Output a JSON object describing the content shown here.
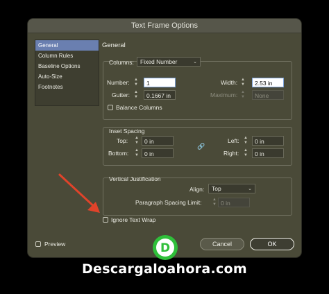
{
  "window": {
    "title": "Text Frame Options"
  },
  "sidebar": {
    "items": [
      {
        "label": "General"
      },
      {
        "label": "Column Rules"
      },
      {
        "label": "Baseline Options"
      },
      {
        "label": "Auto-Size"
      },
      {
        "label": "Footnotes"
      }
    ]
  },
  "general": {
    "title": "General",
    "columns": {
      "label": "Columns:",
      "value": "Fixed Number",
      "number_label": "Number:",
      "number_value": "1",
      "width_label": "Width:",
      "width_value": "2.53 in",
      "gutter_label": "Gutter:",
      "gutter_value": "0.1667 in",
      "maximum_label": "Maximum:",
      "maximum_value": "None",
      "balance_label": "Balance Columns"
    },
    "inset": {
      "title": "Inset Spacing",
      "top_label": "Top:",
      "top_value": "0 in",
      "bottom_label": "Bottom:",
      "bottom_value": "0 in",
      "left_label": "Left:",
      "left_value": "0 in",
      "right_label": "Right:",
      "right_value": "0 in"
    },
    "vertical": {
      "title": "Vertical Justification",
      "align_label": "Align:",
      "align_value": "Top",
      "spacing_label": "Paragraph Spacing Limit:",
      "spacing_value": "0 in"
    },
    "ignore_wrap_label": "Ignore Text Wrap"
  },
  "footer": {
    "preview_label": "Preview",
    "cancel_label": "Cancel",
    "ok_label": "OK"
  },
  "watermark": {
    "logo_letter": "D",
    "text": "Descargaloahora.com"
  },
  "colors": {
    "accent": "#6a7fb0",
    "arrow": "#e0432a",
    "logo": "#2fbf3a"
  }
}
